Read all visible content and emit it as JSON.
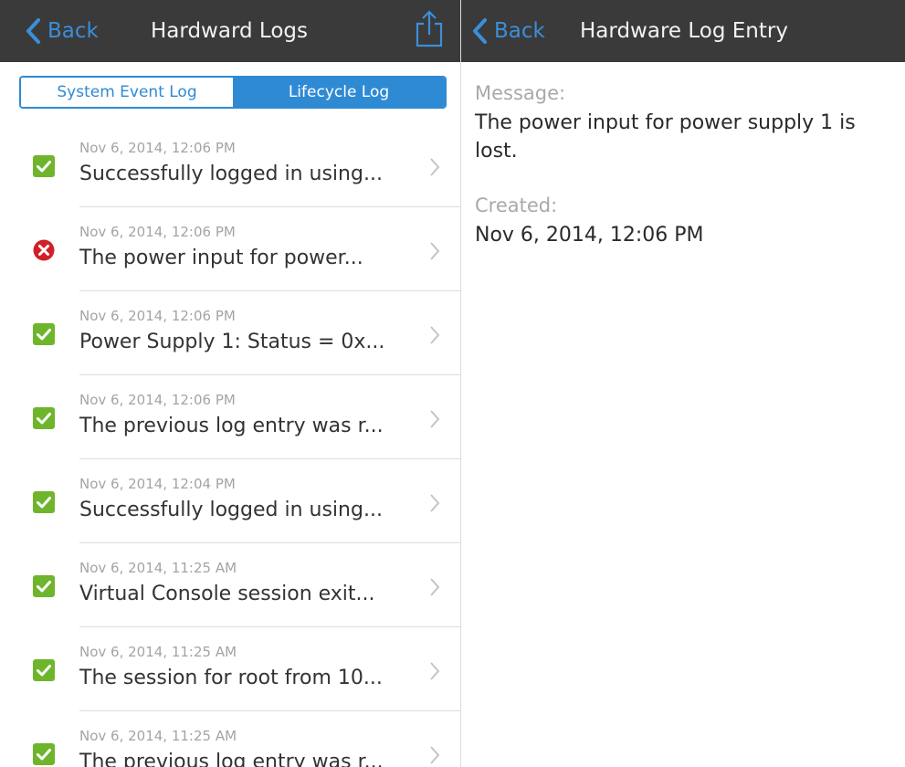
{
  "list_view": {
    "back_label": "Back",
    "title": "Hardward Logs",
    "share_icon": "share-icon",
    "segments": [
      "System Event Log",
      "Lifecycle Log"
    ],
    "selected_segment": "Lifecycle Log",
    "entries": [
      {
        "status": "ok",
        "date": "Nov 6, 2014, 12:06 PM",
        "message": "Successfully logged in using..."
      },
      {
        "status": "error",
        "date": "Nov 6, 2014, 12:06 PM",
        "message": "The power input for power..."
      },
      {
        "status": "ok",
        "date": "Nov 6, 2014, 12:06 PM",
        "message": "Power Supply 1: Status = 0x..."
      },
      {
        "status": "ok",
        "date": "Nov 6, 2014, 12:06 PM",
        "message": "The previous log entry was r..."
      },
      {
        "status": "ok",
        "date": "Nov 6, 2014, 12:04 PM",
        "message": "Successfully logged in using..."
      },
      {
        "status": "ok",
        "date": "Nov 6, 2014, 11:25 AM",
        "message": "Virtual Console session exit..."
      },
      {
        "status": "ok",
        "date": "Nov 6, 2014, 11:25 AM",
        "message": "The session for root from 10..."
      },
      {
        "status": "ok",
        "date": "Nov 6, 2014, 11:25 AM",
        "message": "The previous log entry was r..."
      }
    ]
  },
  "detail_view": {
    "back_label": "Back",
    "title": "Hardware Log Entry",
    "message_label": "Message:",
    "message_value": "The power input for power supply 1 is lost.",
    "created_label": "Created:",
    "created_value": "Nov 6, 2014, 12:06 PM"
  },
  "colors": {
    "navbar": "#3a3a3a",
    "accent": "#2f8ad4",
    "ok": "#6fb52c",
    "error": "#d0202a"
  }
}
